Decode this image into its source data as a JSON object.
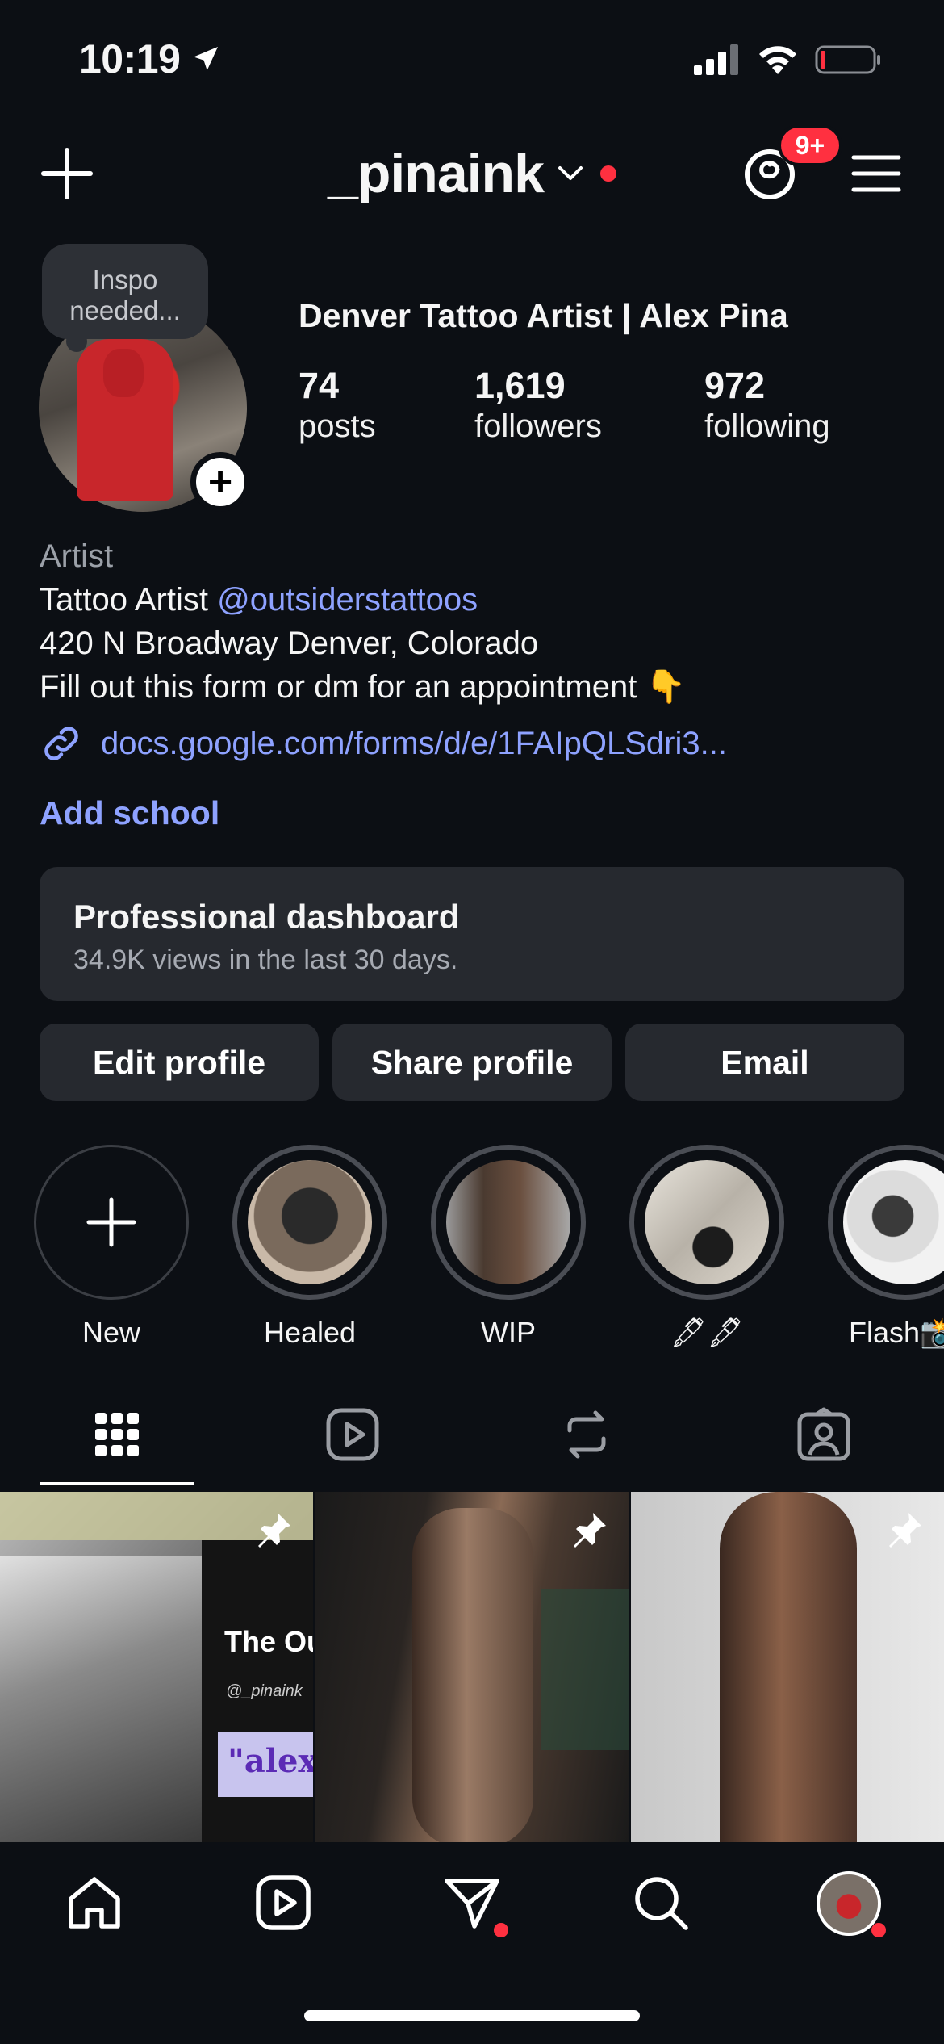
{
  "status_bar": {
    "time": "10:19",
    "icons": [
      "location-arrow-icon",
      "cellular-signal-icon",
      "wifi-icon",
      "battery-low-icon"
    ]
  },
  "header": {
    "username": "_pinaink",
    "threads_badge": "9+",
    "icons": [
      "plus-icon",
      "chevron-down-icon",
      "threads-icon",
      "hamburger-menu-icon"
    ]
  },
  "profile": {
    "note": "Inspo needed...",
    "display_name": "Denver Tattoo Artist | Alex Pina",
    "stats": [
      {
        "value": "74",
        "label": "posts"
      },
      {
        "value": "1,619",
        "label": "followers"
      },
      {
        "value": "972",
        "label": "following"
      }
    ]
  },
  "bio": {
    "category": "Artist",
    "line1_prefix": "Tattoo Artist ",
    "line1_mention": "@outsiderstattoos",
    "line2": "420 N Broadway Denver, Colorado",
    "line3": "Fill out this form or dm for an appointment 👇",
    "link": "docs.google.com/forms/d/e/1FAIpQLSdri3...",
    "add_school": "Add school"
  },
  "dashboard": {
    "title": "Professional dashboard",
    "subtitle": "34.9K views in the last 30 days."
  },
  "actions": {
    "edit": "Edit profile",
    "share": "Share profile",
    "email": "Email"
  },
  "highlights": [
    {
      "label": "New"
    },
    {
      "label": "Healed"
    },
    {
      "label": "WIP"
    },
    {
      "label": "🖋🖋"
    },
    {
      "label": "Flash📸"
    }
  ],
  "grid_post_text": {
    "the_outsiders": "The Outsid",
    "handle": "@_pinaink",
    "alex": "\"alex"
  },
  "colors": {
    "background": "#0c0f14",
    "card": "#26292f",
    "link": "#8ea2ff",
    "notification": "#ff3040"
  }
}
